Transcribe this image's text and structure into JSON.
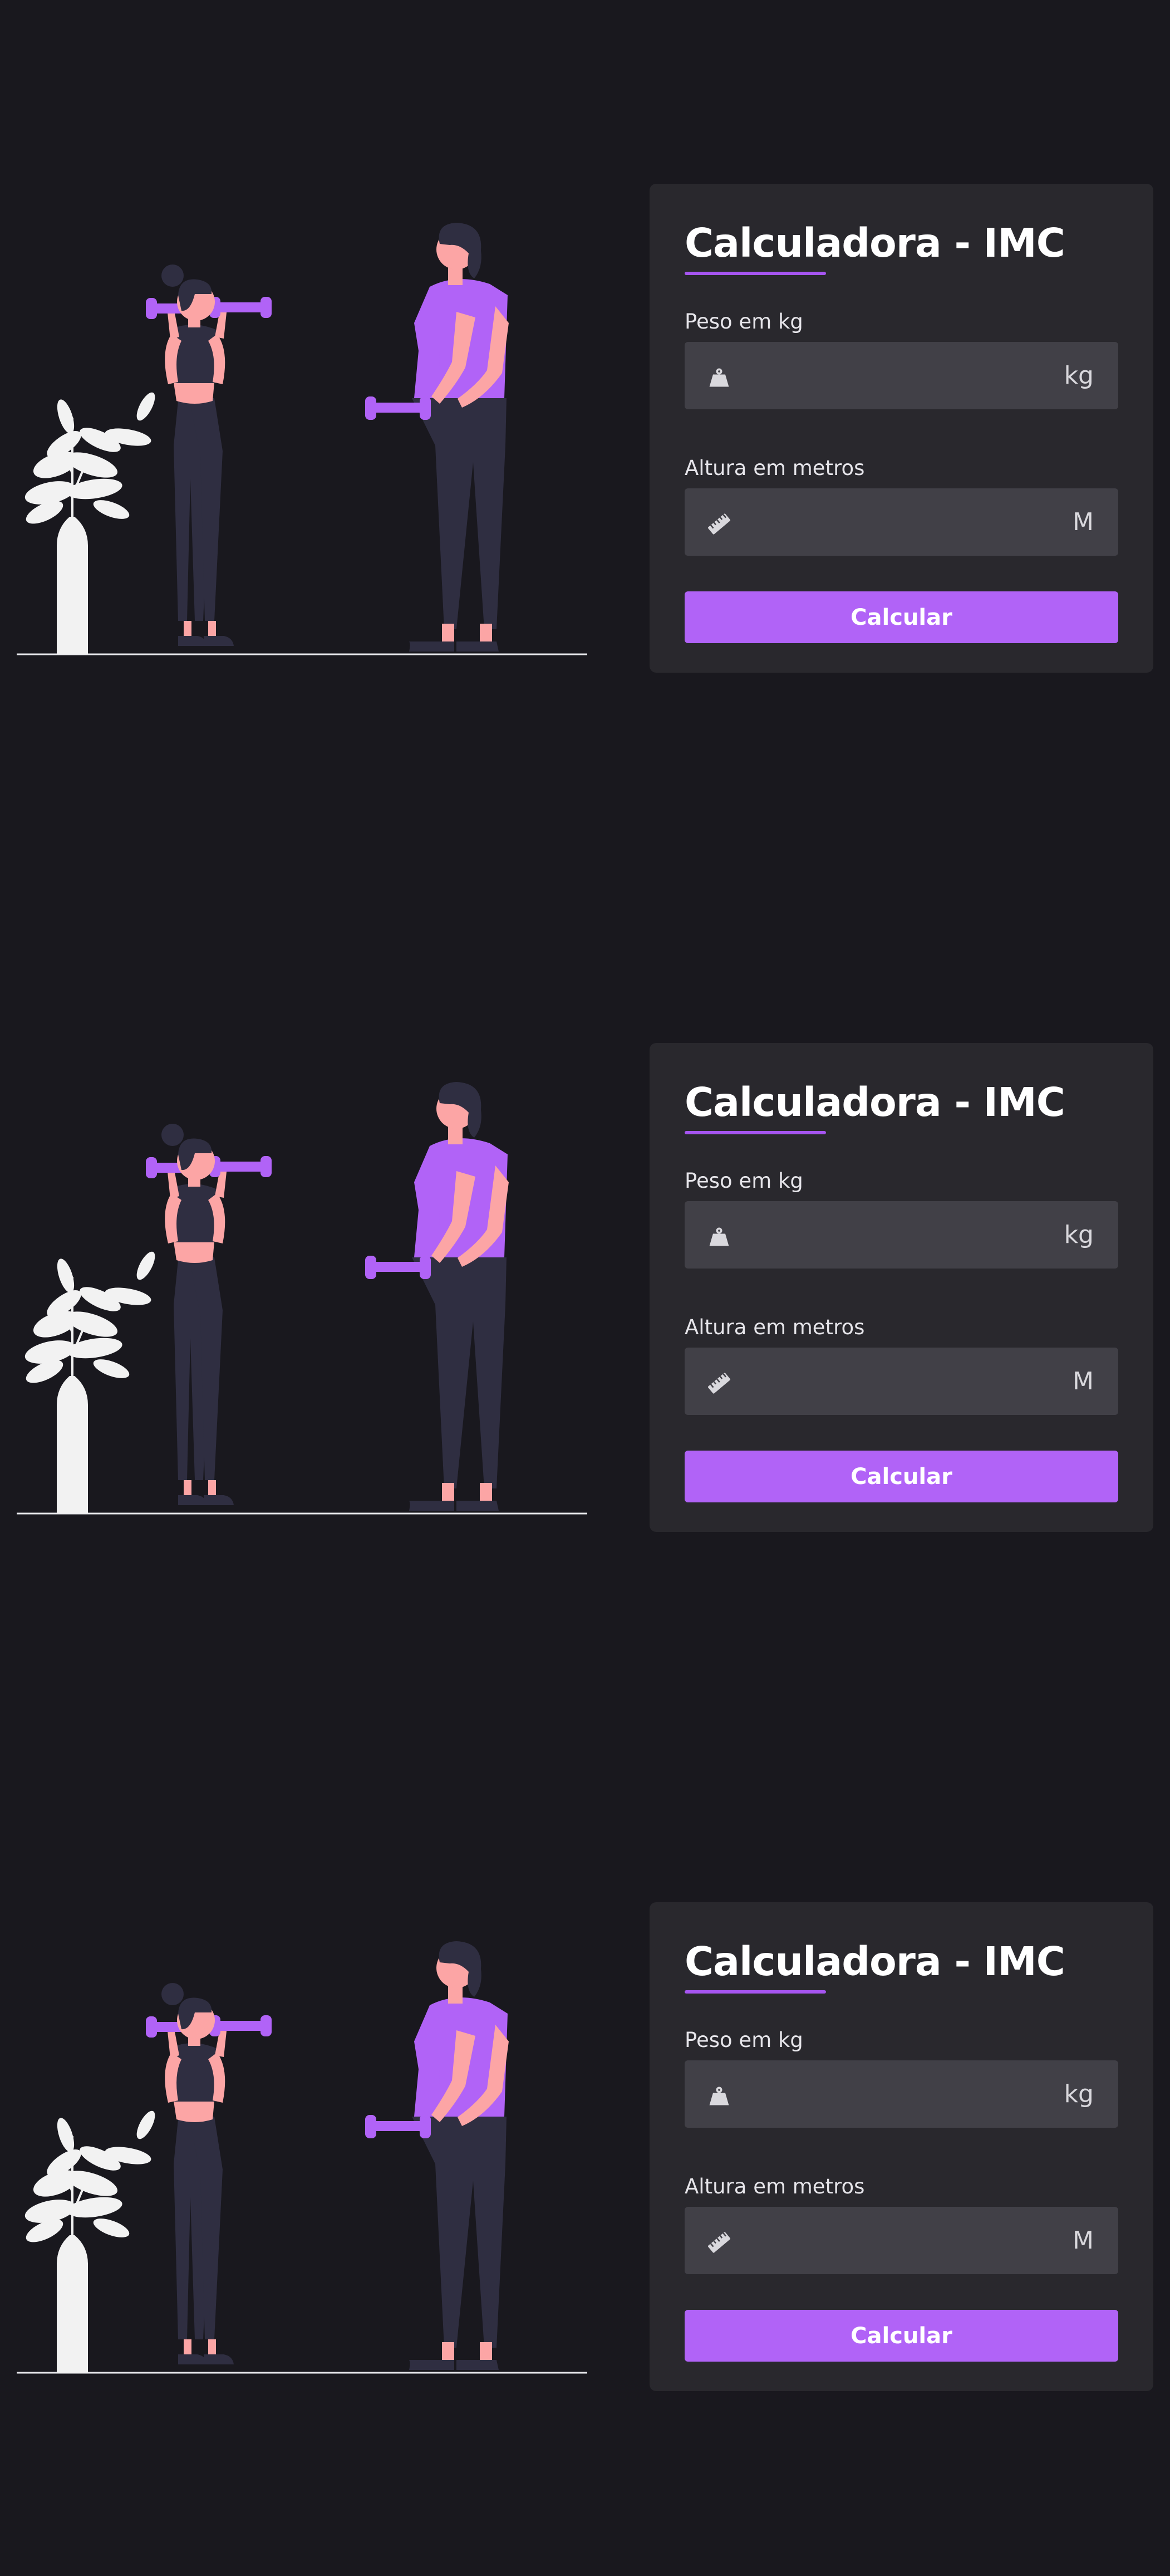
{
  "theme": {
    "background": "#19181e",
    "card": "#29282d",
    "input": "#414047",
    "accent": "#b163f7",
    "skin": "#fca5a5",
    "dark_clothes": "#2f2e41",
    "plant": "#f2f2f2"
  },
  "sections": [
    {
      "title": "Calculadora - IMC",
      "weight": {
        "label": "Peso em kg",
        "value": "",
        "placeholder": "",
        "unit": "kg",
        "icon": "weight-icon"
      },
      "height": {
        "label": "Altura em metros",
        "value": "",
        "placeholder": "",
        "unit": "M",
        "icon": "ruler-icon"
      },
      "button_label": "Calcular"
    },
    {
      "title": "Calculadora - IMC",
      "weight": {
        "label": "Peso em kg",
        "value": "",
        "placeholder": "",
        "unit": "kg",
        "icon": "weight-icon"
      },
      "height": {
        "label": "Altura em metros",
        "value": "",
        "placeholder": "",
        "unit": "M",
        "icon": "ruler-icon"
      },
      "button_label": "Calcular"
    },
    {
      "title": "Calculadora - IMC",
      "weight": {
        "label": "Peso em kg",
        "value": "",
        "placeholder": "",
        "unit": "kg",
        "icon": "weight-icon"
      },
      "height": {
        "label": "Altura em metros",
        "value": "",
        "placeholder": "",
        "unit": "M",
        "icon": "ruler-icon"
      },
      "button_label": "Calcular"
    }
  ]
}
